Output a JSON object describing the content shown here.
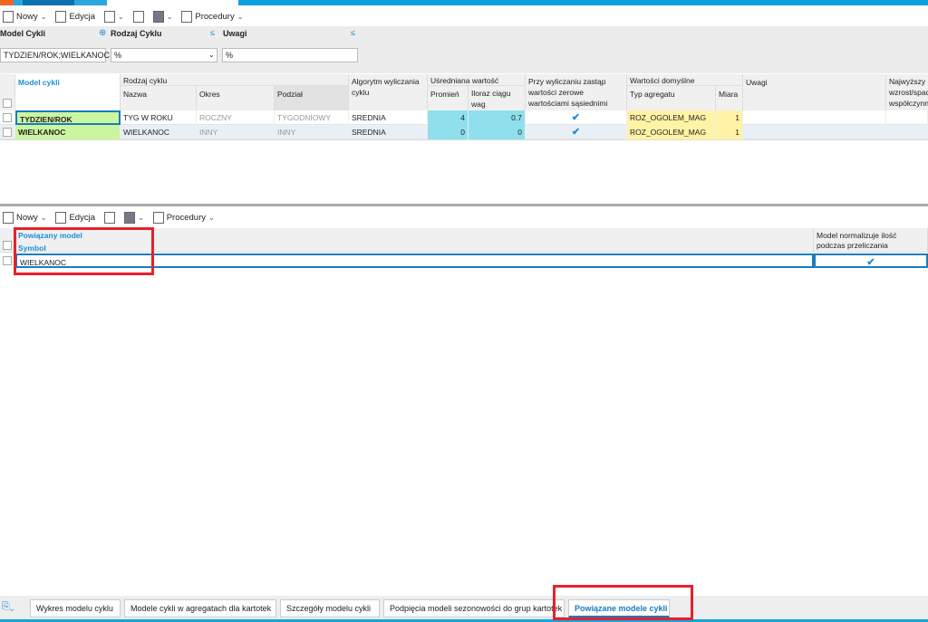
{
  "toolbar": {
    "new": "Nowy",
    "edit": "Edycja",
    "procedures": "Procedury"
  },
  "filters": {
    "model": {
      "label": "Model Cykli",
      "value": "TYDZIEN/ROK;WIELKANOC"
    },
    "type": {
      "label": "Rodzaj Cyklu",
      "value": "%"
    },
    "notes": {
      "label": "Uwagi",
      "value": "%"
    }
  },
  "grid": {
    "headers": {
      "model": "Model cykli",
      "cycle_type": "Rodzaj cyklu",
      "name": "Nazwa",
      "period": "Okres",
      "division": "Podział",
      "algorithm": "Algorytm wyliczania cyklu",
      "averaged": "Uśredniana wartość",
      "radius": "Promień",
      "ratio": "Iloraz ciągu wag",
      "replace": "Przy wyliczaniu zastąp wartości zerowe wartościami sąsiednimi",
      "defaults": "Wartości domyślne",
      "agg_type": "Typ agregatu",
      "measure": "Miara",
      "notes": "Uwagi",
      "highest": "Najwyższy wzrost/spadek współczynnika"
    },
    "rows": [
      {
        "model": "TYDZIEN/ROK",
        "name": "TYG W ROKU",
        "period": "ROCZNY",
        "division": "TYGODNIOWY",
        "algorithm": "SREDNIA",
        "radius": "4",
        "ratio": "0.7",
        "replace": true,
        "agg_type": "ROZ_OGOLEM_MAG",
        "measure": "1"
      },
      {
        "model": "WIELKANOC",
        "name": "WIELKANOC",
        "period": "INNY",
        "division": "INNY",
        "algorithm": "SREDNIA",
        "radius": "0",
        "ratio": "0",
        "replace": true,
        "agg_type": "ROZ_OGOLEM_MAG",
        "measure": "1"
      }
    ]
  },
  "lower_grid": {
    "headers": {
      "linked": "Powiązany model",
      "symbol": "Symbol",
      "normalize": "Model normalizuje ilość podczas przeliczania"
    },
    "rows": [
      {
        "symbol": "WIELKANOC",
        "normalize": true
      }
    ]
  },
  "tabs": [
    "Wykres modelu cyklu",
    "Modele cykli w agregatach dla kartotek",
    "Szczegóły modelu cykli",
    "Podpięcia modeli sezonowości do grup kartotek",
    "Powiązane modele cykli"
  ],
  "active_tab": "Powiązane modele cykli",
  "colors": {
    "accent": "#1a8fd8",
    "highlight_red": "#e8202c",
    "green_cell": "#ccf5a0",
    "cyan_cell": "#8fe0ec",
    "yellow_cell": "#fff3a6"
  }
}
